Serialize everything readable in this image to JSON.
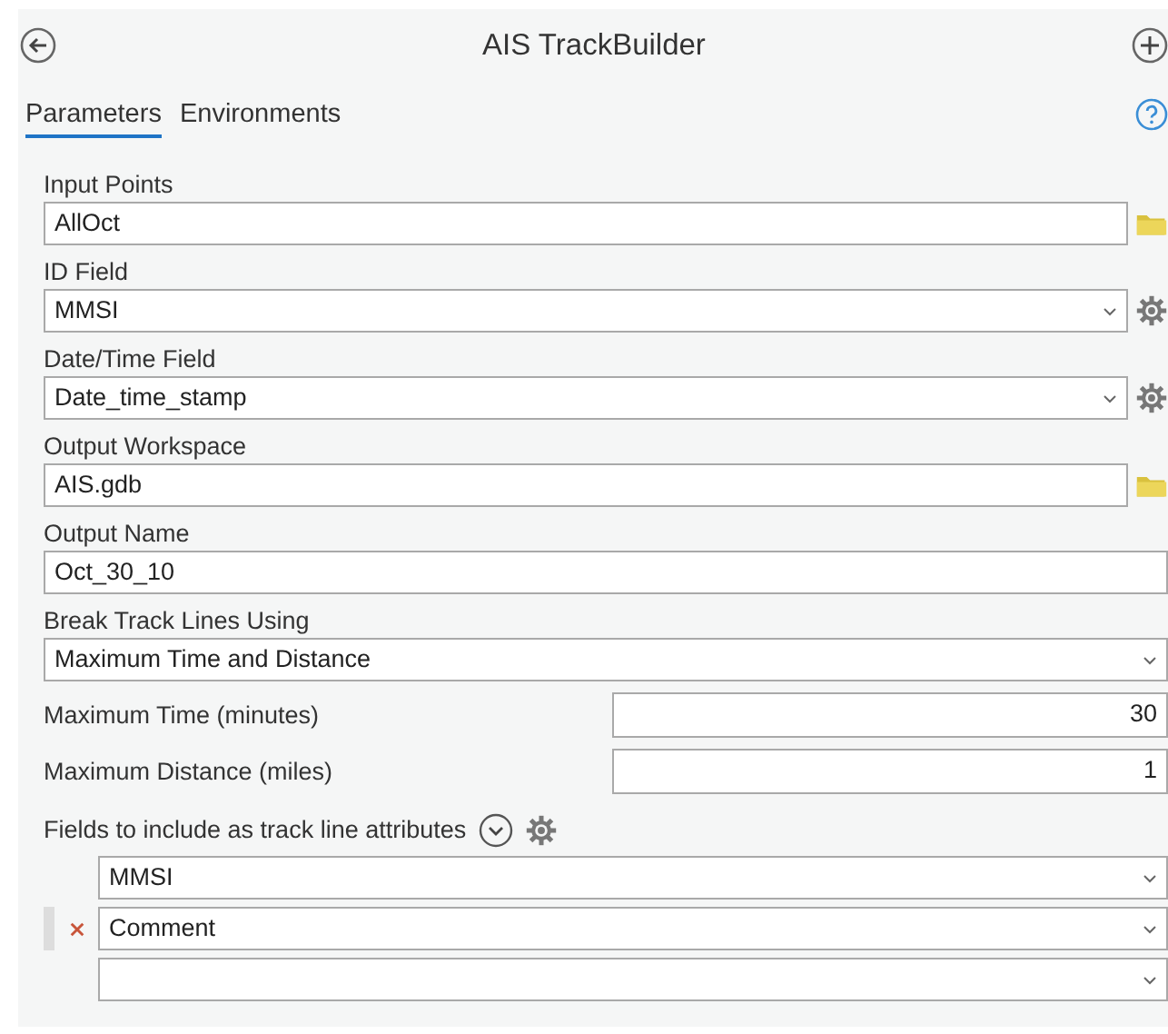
{
  "header": {
    "title": "AIS TrackBuilder"
  },
  "tabs": [
    {
      "label": "Parameters",
      "selected": true
    },
    {
      "label": "Environments",
      "selected": false
    }
  ],
  "parameters": [
    {
      "kind": "text-folder",
      "label": "Input Points",
      "value": "AllOct"
    },
    {
      "kind": "dropdown-gear",
      "label": "ID Field",
      "value": "MMSI"
    },
    {
      "kind": "dropdown-gear",
      "label": "Date/Time Field",
      "value": "Date_time_stamp"
    },
    {
      "kind": "text-folder",
      "label": "Output Workspace",
      "value": "AIS.gdb"
    },
    {
      "kind": "text",
      "label": "Output Name",
      "value": "Oct_30_10"
    },
    {
      "kind": "dropdown",
      "label": "Break Track Lines Using",
      "value": "Maximum Time and Distance"
    },
    {
      "kind": "number",
      "label": "Maximum Time (minutes)",
      "value": "30"
    },
    {
      "kind": "number",
      "label": "Maximum Distance (miles)",
      "value": "1"
    },
    {
      "kind": "multivalue",
      "label": "Fields to include as track line attributes",
      "items": [
        {
          "value": "MMSI",
          "selected": false
        },
        {
          "value": "Comment",
          "selected": true
        },
        {
          "value": "",
          "selected": false
        }
      ]
    }
  ]
}
